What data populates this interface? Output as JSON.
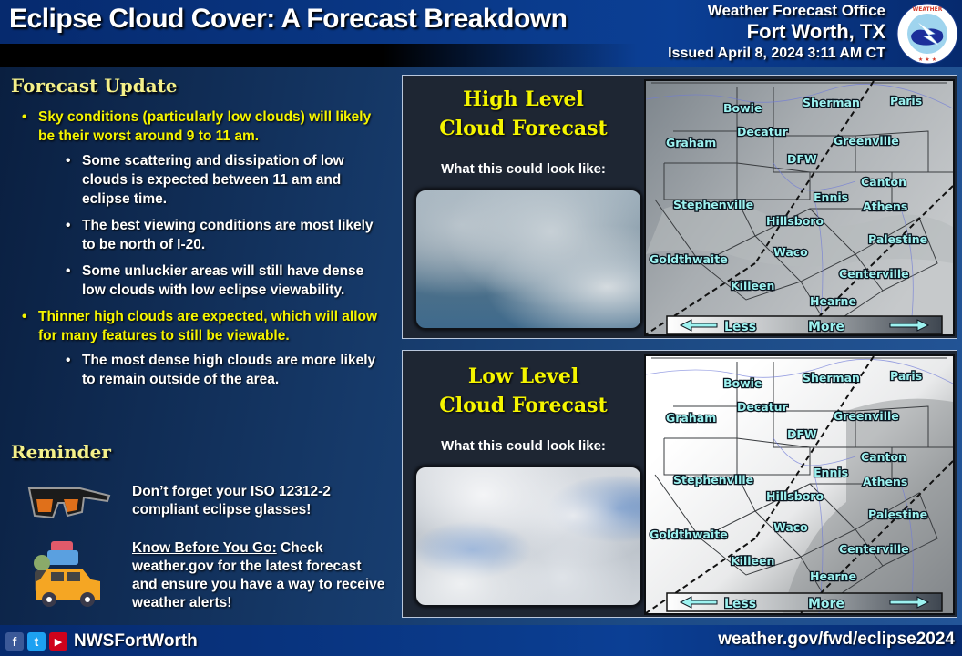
{
  "header": {
    "title": "Eclipse Cloud Cover: A Forecast Breakdown",
    "office_line1": "Weather Forecast Office",
    "office_line2": "Fort Worth, TX",
    "issued": "Issued April 8, 2024 3:11 AM CT",
    "logo_icon": "nws-logo-icon"
  },
  "forecast_update": {
    "heading": "Forecast Update",
    "bullets": [
      {
        "text": "Sky conditions (particularly low clouds) will likely be their worst around 9 to 11 am.",
        "sub": [
          "Some scattering and dissipation of low clouds is expected between 11 am and eclipse time.",
          "The best viewing conditions are most likely to be north of I-20.",
          "Some unluckier areas will still have dense low clouds with low eclipse viewability."
        ]
      },
      {
        "text": "Thinner high clouds are expected, which will allow for many features to still be viewable.",
        "sub": [
          "The most dense high clouds are more likely to remain outside of the area."
        ]
      }
    ]
  },
  "reminder": {
    "heading": "Reminder",
    "items": [
      {
        "icon": "eclipse-glasses-icon",
        "text": "Don’t forget your ISO 12312-2 compliant eclipse glasses!"
      },
      {
        "icon": "car-luggage-icon",
        "label": "Know Before You Go:",
        "text": " Check weather.gov for the latest forecast and ensure you have a way to receive weather alerts!"
      }
    ]
  },
  "panels": [
    {
      "title_line1": "High Level",
      "title_line2": "Cloud Forecast",
      "subtitle": "What this could look like:",
      "photo": "high-cloud-photo",
      "legend_less": "Less",
      "legend_more": "More"
    },
    {
      "title_line1": "Low Level",
      "title_line2": "Cloud Forecast",
      "subtitle": "What this could look like:",
      "photo": "low-cloud-photo",
      "legend_less": "Less",
      "legend_more": "More"
    }
  ],
  "map_cities": [
    "Bowie",
    "Sherman",
    "Paris",
    "Decatur",
    "Graham",
    "Greenville",
    "DFW",
    "Canton",
    "Stephenville",
    "Ennis",
    "Athens",
    "Hillsboro",
    "Palestine",
    "Goldthwaite",
    "Waco",
    "Centerville",
    "Killeen",
    "Hearne"
  ],
  "footer": {
    "social": [
      "facebook-icon",
      "twitter-icon",
      "youtube-icon"
    ],
    "handle": "NWSFortWorth",
    "url": "weather.gov/fwd/eclipse2024"
  },
  "colors": {
    "heading_yellow": "#f4f08a",
    "bullet_yellow": "#f5f500",
    "city_label": "#9df2f0",
    "header_blue": "#0a3a8a"
  }
}
